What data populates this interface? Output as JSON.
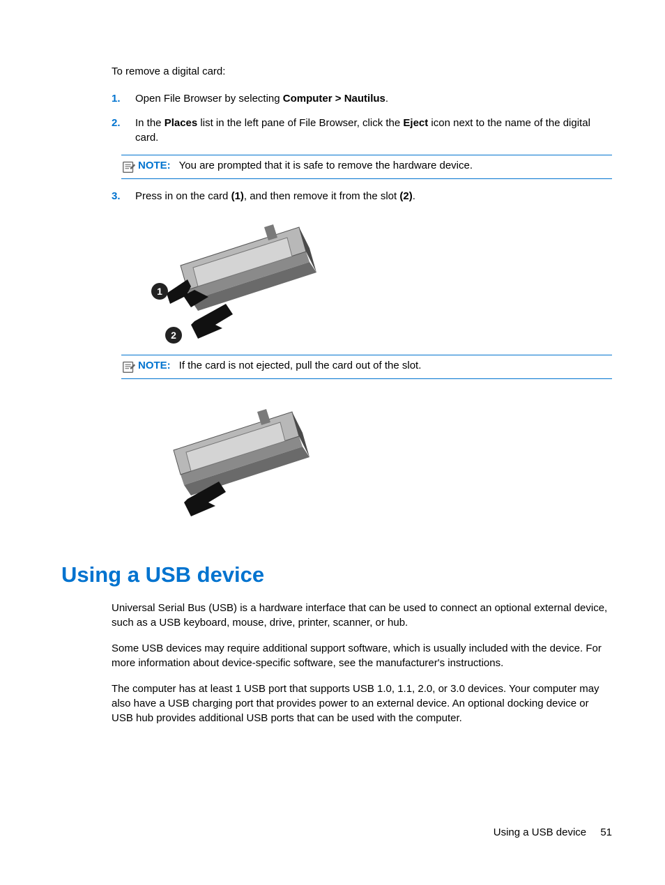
{
  "intro": "To remove a digital card:",
  "steps": {
    "s1_num": "1.",
    "s1_pre": "Open File Browser by selecting ",
    "s1_bold": "Computer > Nautilus",
    "s1_post": ".",
    "s2_num": "2.",
    "s2_a": "In the ",
    "s2_b": "Places",
    "s2_c": " list in the left pane of File Browser, click the ",
    "s2_d": "Eject",
    "s2_e": " icon next to the name of the digital card.",
    "s3_num": "3.",
    "s3_a": "Press in on the card ",
    "s3_b": "(1)",
    "s3_c": ", and then remove it from the slot ",
    "s3_d": "(2)",
    "s3_e": "."
  },
  "notes": {
    "label": "NOTE:",
    "n1": "You are prompted that it is safe to remove the hardware device.",
    "n2": "If the card is not ejected, pull the card out of the slot."
  },
  "heading": "Using a USB device",
  "body": {
    "p1": "Universal Serial Bus (USB) is a hardware interface that can be used to connect an optional external device, such as a USB keyboard, mouse, drive, printer, scanner, or hub.",
    "p2": "Some USB devices may require additional support software, which is usually included with the device. For more information about device-specific software, see the manufacturer's instructions.",
    "p3": "The computer has at least 1 USB port that supports USB 1.0, 1.1, 2.0, or 3.0 devices. Your computer may also have a USB charging port that provides power to an external device. An optional docking device or USB hub provides additional USB ports that can be used with the computer."
  },
  "footer": {
    "title": "Using a USB device",
    "page": "51"
  }
}
